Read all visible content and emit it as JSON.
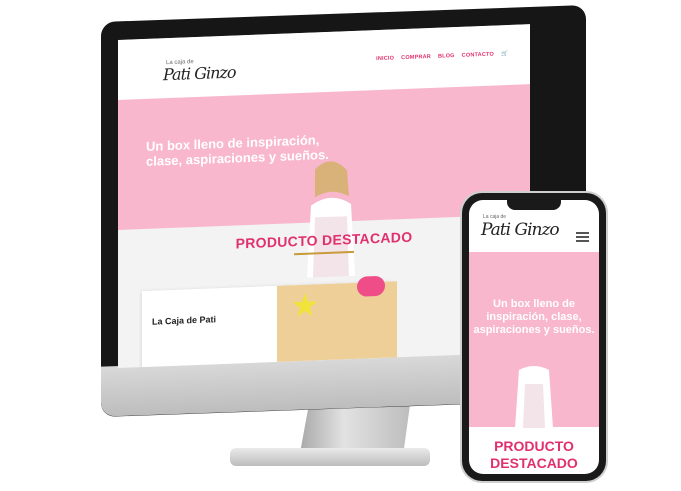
{
  "desktop": {
    "logo_small": "La caja de",
    "logo": "Pati Ginzo",
    "nav": [
      "INICIO",
      "COMPRAR",
      "BLOG",
      "CONTACTO"
    ],
    "cart_icon": "cart-icon",
    "hero_text": "Un box lleno de inspiración, clase, aspiraciones y sueños.",
    "featured_title": "PRODUCTO DESTACADO",
    "card_title": "La Caja de Pati",
    "accent": "#e0306e",
    "hero_bg": "#f8b7cd"
  },
  "phone": {
    "logo_small": "La caja de",
    "logo": "Pati Ginzo",
    "menu_icon": "hamburger-menu-icon",
    "hero_text": "Un box lleno de inspiración, clase, aspiraciones y sueños.",
    "featured_title": "PRODUCTO DESTACADO"
  }
}
